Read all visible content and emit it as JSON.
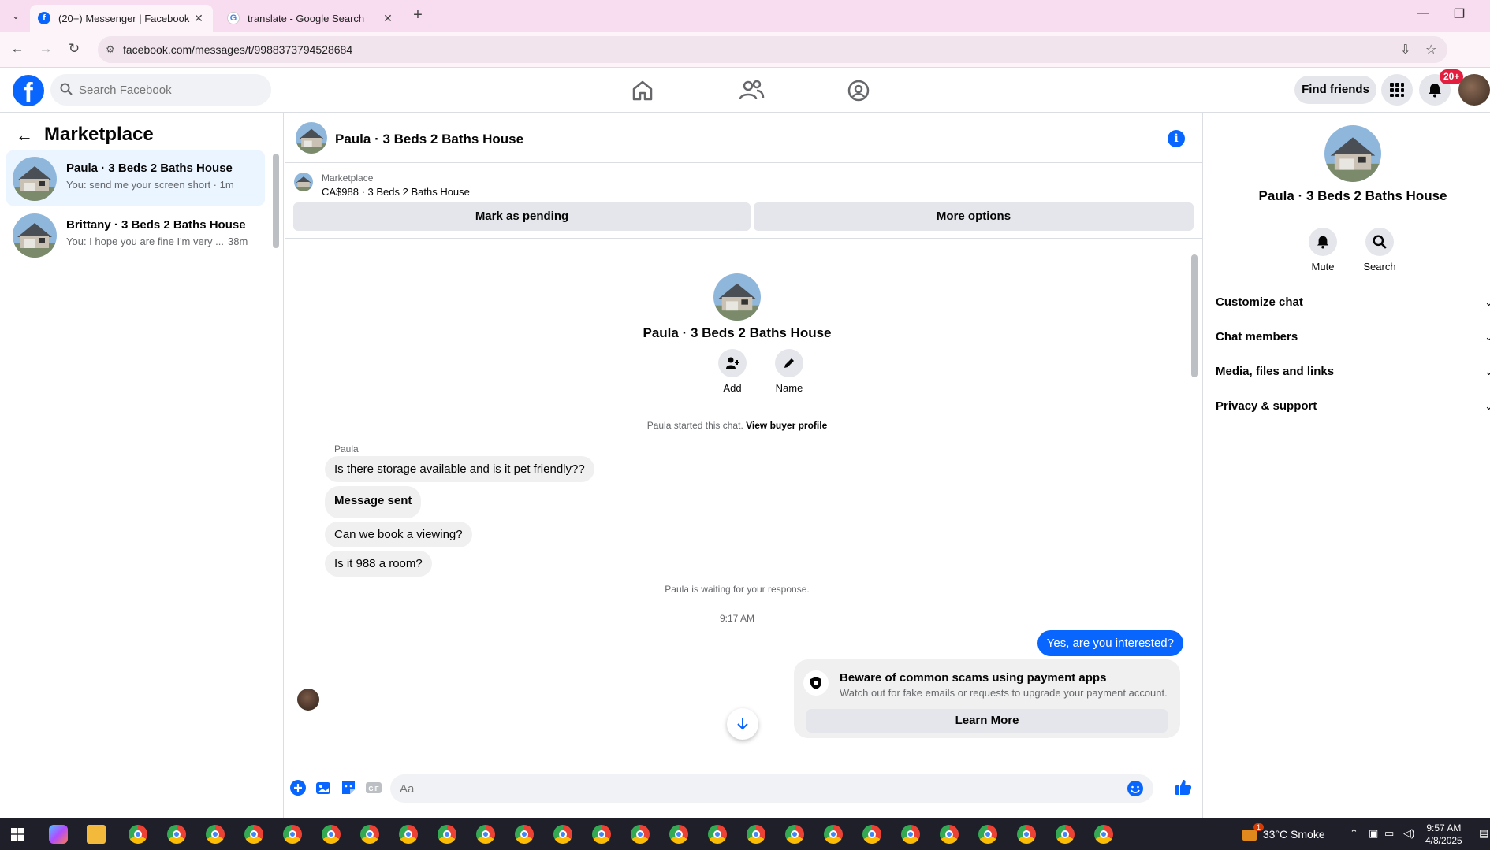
{
  "browser": {
    "tabs": [
      {
        "title": "(20+) Messenger | Facebook",
        "active": true
      },
      {
        "title": "translate - Google Search",
        "active": false
      }
    ],
    "url": "facebook.com/messages/t/9988373794528684"
  },
  "header": {
    "search_placeholder": "Search Facebook",
    "find_friends": "Find friends",
    "notif_badge": "20+"
  },
  "sidebar": {
    "title": "Marketplace",
    "conversations": [
      {
        "name": "Paula · 3 Beds 2 Baths House",
        "preview": "You: send me your screen short · 1m",
        "selected": true
      },
      {
        "name": "Brittany · 3 Beds 2 Baths House",
        "preview": "You: I hope you are fine I'm very ...",
        "time": "38m",
        "selected": false
      }
    ]
  },
  "chat": {
    "title": "Paula · 3 Beds 2 Baths House",
    "listing": {
      "label": "Marketplace",
      "price_title": "CA$988 · 3 Beds 2 Baths House"
    },
    "mark_pending": "Mark as pending",
    "more_options": "More options",
    "intro_name": "Paula · 3 Beds 2 Baths House",
    "add_label": "Add",
    "name_label": "Name",
    "started_text": "Paula started this chat.",
    "view_profile": "View buyer profile",
    "sender": "Paula",
    "messages": [
      {
        "text": "Is there storage available and is it pet friendly??"
      },
      {
        "text": "Message sent"
      },
      {
        "text": "Can we book a viewing?"
      },
      {
        "text": "Is it 988 a room?"
      }
    ],
    "waiting_text": "Paula is waiting for your response.",
    "timestamp": "9:17 AM",
    "my_message": "Yes, are you interested?",
    "scam": {
      "title": "Beware of common scams using payment apps",
      "body": "Watch out for fake emails or requests to upgrade your payment account.",
      "button": "Learn More"
    },
    "composer_placeholder": "Aa"
  },
  "details": {
    "name": "Paula · 3 Beds 2 Baths House",
    "mute": "Mute",
    "search": "Search",
    "sections": [
      "Customize chat",
      "Chat members",
      "Media, files and links",
      "Privacy & support"
    ]
  },
  "taskbar": {
    "weather": "33°C  Smoke",
    "weather_badge": "1",
    "time": "9:57 AM",
    "date": "4/8/2025"
  },
  "colors": {
    "accent": "#0866ff",
    "tab_bar": "#f8dcef",
    "taskbar": "#1f1f2a"
  }
}
